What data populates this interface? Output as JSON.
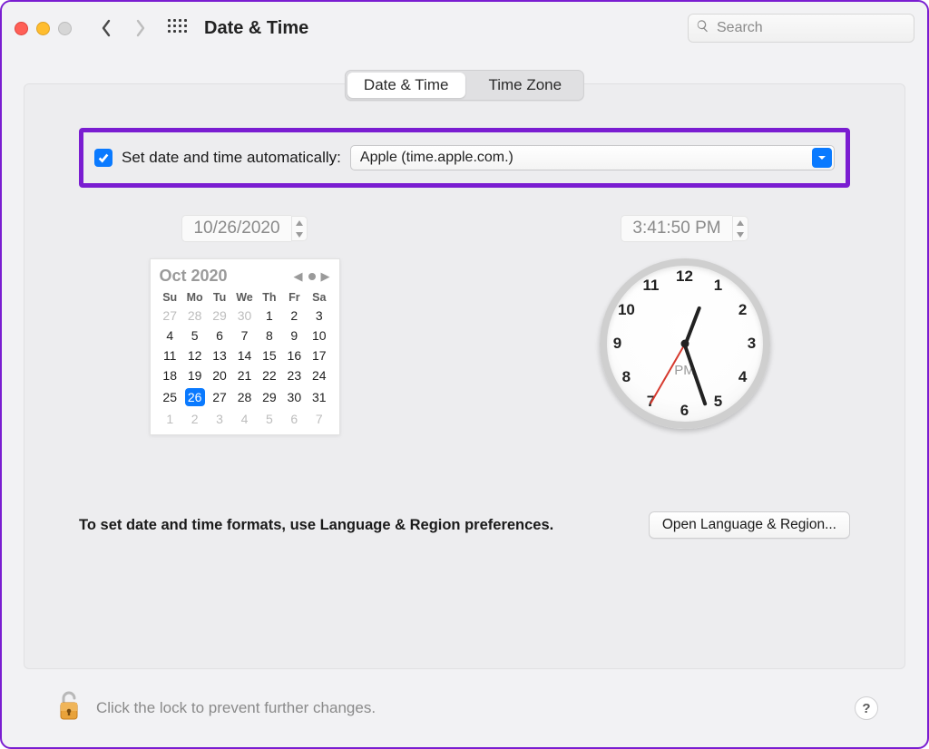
{
  "header": {
    "title": "Date & Time",
    "search_placeholder": "Search"
  },
  "tabs": {
    "active": "Date & Time",
    "inactive": "Time Zone"
  },
  "auto": {
    "checked": true,
    "label": "Set date and time automatically:",
    "server": "Apple (time.apple.com.)"
  },
  "date_field": "10/26/2020",
  "time_field": "3:41:50 PM",
  "calendar": {
    "title": "Oct 2020",
    "weekdays": [
      "Su",
      "Mo",
      "Tu",
      "We",
      "Th",
      "Fr",
      "Sa"
    ],
    "leading": [
      27,
      28,
      29,
      30
    ],
    "days": [
      1,
      2,
      3,
      4,
      5,
      6,
      7,
      8,
      9,
      10,
      11,
      12,
      13,
      14,
      15,
      16,
      17,
      18,
      19,
      20,
      21,
      22,
      23,
      24,
      25,
      26,
      27,
      28,
      29,
      30,
      31
    ],
    "trailing": [
      1,
      2,
      3,
      4,
      5,
      6,
      7
    ],
    "selected": 26
  },
  "clock": {
    "ampm": "PM",
    "hour_angle": 20.9,
    "minute_angle": 161.0,
    "second_angle": 210.0
  },
  "hint": "To set date and time formats, use Language & Region preferences.",
  "open_button": "Open Language & Region...",
  "footer": "Click the lock to prevent further changes.",
  "help": "?"
}
